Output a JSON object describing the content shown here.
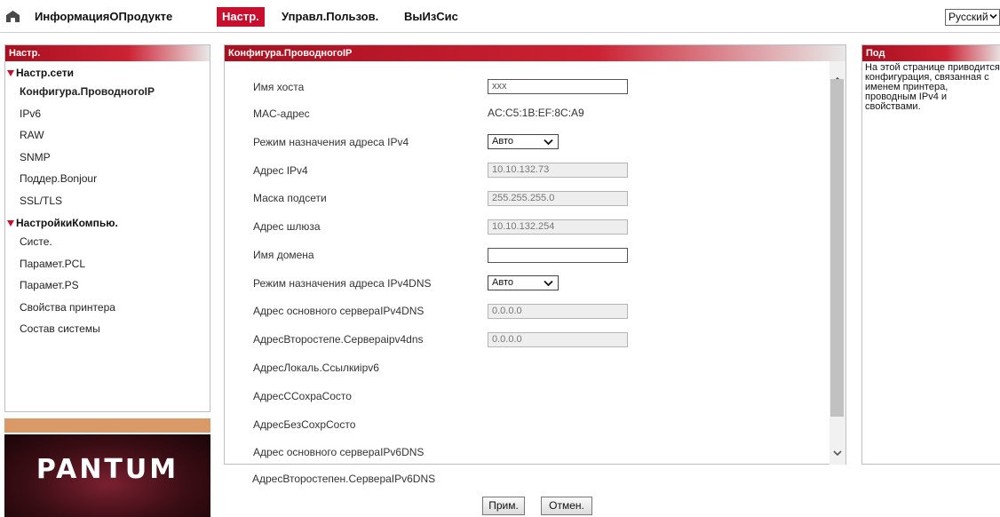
{
  "topnav": {
    "home_icon": "home-icon",
    "items": [
      "ИнформацияОПродукте",
      "Настр.",
      "Управл.Пользов.",
      "ВыИзСис"
    ],
    "active_index": 1,
    "language": "Русский"
  },
  "sidebar": {
    "title": "Настр.",
    "groups": [
      {
        "label": "Настр.сети",
        "items": [
          "Конфигура.ПроводногоIP",
          "IPv6",
          "RAW",
          "SNMP",
          "Поддер.Bonjour",
          "SSL/TLS"
        ]
      },
      {
        "label": "НастройкиКомпью.",
        "items": [
          "Систе.",
          "Парамет.PCL",
          "Парамет.PS",
          "Свойства принтера",
          "Состав системы"
        ]
      }
    ],
    "selected": "Конфигура.ПроводногоIP",
    "logo_text": "PANTUM"
  },
  "main": {
    "title": "Конфигура.ПроводногоIP",
    "rows": [
      {
        "label": "Имя хоста",
        "value": "xxx",
        "kind": "text"
      },
      {
        "label": "MAC-адрес",
        "value": "AC:C5:1B:EF:8C:A9",
        "kind": "plain"
      },
      {
        "label": "Режим назначения адреса IPv4",
        "value": "Авто",
        "kind": "select"
      },
      {
        "label": "Адрес IPv4",
        "value": "10.10.132.73",
        "kind": "disabled"
      },
      {
        "label": "Маска подсети",
        "value": "255.255.255.0",
        "kind": "disabled"
      },
      {
        "label": "Адрес шлюза",
        "value": "10.10.132.254",
        "kind": "disabled"
      },
      {
        "label": "Имя домена",
        "value": "",
        "kind": "text"
      },
      {
        "label": "Режим назначения адреса IPv4DNS",
        "value": "Авто",
        "kind": "select"
      },
      {
        "label": "Адрес основного сервераIPv4DNS",
        "value": "0.0.0.0",
        "kind": "disabled"
      },
      {
        "label": "АдресВторостепе.Сервераipv4dns",
        "value": "0.0.0.0",
        "kind": "disabled"
      },
      {
        "label": "АдресЛокаль.Ссылкиipv6",
        "value": "",
        "kind": "none"
      },
      {
        "label": "АдресССохраСосто",
        "value": "",
        "kind": "none"
      },
      {
        "label": "АдресБезСохрСосто",
        "value": "",
        "kind": "none"
      },
      {
        "label": "Адрес основного сервераIPv6DNS",
        "value": "",
        "kind": "none"
      },
      {
        "label": "АдресВторостепен.СервераIPv6DNS",
        "value": "",
        "kind": "none"
      }
    ]
  },
  "buttons": {
    "apply": "Прим.",
    "cancel": "Отмен."
  },
  "help": {
    "title": "Под",
    "text": "На этой странице приводится конфигурация, связанная с именем принтера, проводным IPv4 и свойствами."
  },
  "colors": {
    "accent": "#c8102e",
    "brand_strip": "#d99a68"
  }
}
